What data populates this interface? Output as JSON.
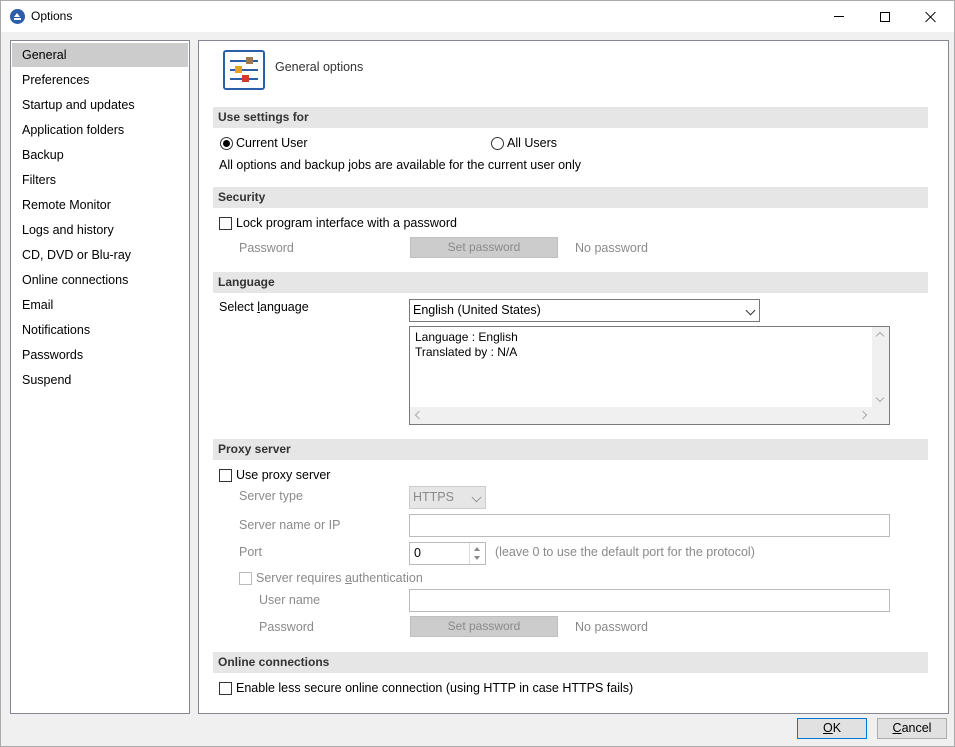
{
  "window": {
    "title": "Options"
  },
  "sidebar": {
    "items": [
      {
        "label": "General"
      },
      {
        "label": "Preferences"
      },
      {
        "label": "Startup and updates"
      },
      {
        "label": "Application folders"
      },
      {
        "label": "Backup"
      },
      {
        "label": "Filters"
      },
      {
        "label": "Remote Monitor"
      },
      {
        "label": "Logs and history"
      },
      {
        "label": "CD, DVD or Blu-ray"
      },
      {
        "label": "Online connections"
      },
      {
        "label": "Email"
      },
      {
        "label": "Notifications"
      },
      {
        "label": "Passwords"
      },
      {
        "label": "Suspend"
      }
    ],
    "selected": "General"
  },
  "header": {
    "title": "General options",
    "icon": "sliders-icon"
  },
  "use_settings": {
    "section_title": "Use settings for",
    "current_user_label": "Current User",
    "all_users_label": "All Users",
    "selected": "Current User",
    "info": "All options and backup jobs are available for the current user only"
  },
  "security": {
    "section_title": "Security",
    "lock_label": "Lock program interface with a password",
    "password_label": "Password",
    "set_password_label": "Set password",
    "status": "No password"
  },
  "language": {
    "section_title": "Language",
    "select_label_pre": "Select ",
    "select_label_ul": "l",
    "select_label_post": "anguage",
    "selected": "English (United States)",
    "info_line1": "Language : English",
    "info_line2": "Translated by : N/A"
  },
  "proxy": {
    "section_title": "Proxy server",
    "use_proxy_label": "Use proxy server",
    "server_type_label": "Server type",
    "server_type_value": "HTTPS",
    "server_name_label": "Server name or IP",
    "server_name_value": "",
    "port_label": "Port",
    "port_value": "0",
    "port_hint": "(leave 0 to use the default port for the protocol)",
    "auth_label_pre": "Server requires ",
    "auth_label_ul": "a",
    "auth_label_post": "uthentication",
    "user_name_label": "User name",
    "user_name_value": "",
    "password_label": "Password",
    "set_password_label": "Set password",
    "status": "No password"
  },
  "online": {
    "section_title": "Online connections",
    "less_secure_label": "Enable less secure online connection (using HTTP in case HTTPS fails)"
  },
  "footer": {
    "ok_ul": "O",
    "ok_post": "K",
    "cancel_ul": "C",
    "cancel_post": "ancel"
  },
  "colors": {
    "accent": "#2a5ea8",
    "selected_bg": "#cccccc",
    "section_bg": "#e6e6e6"
  }
}
